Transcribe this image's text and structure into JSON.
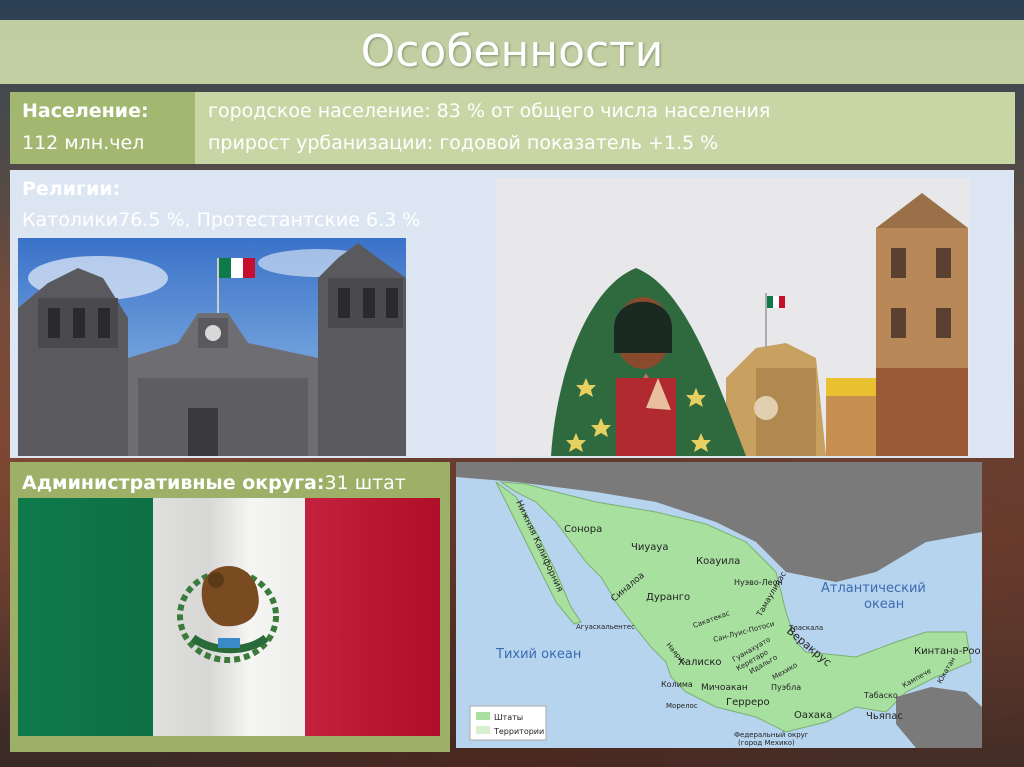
{
  "title": "Особенности",
  "population": {
    "label": "Население:",
    "value": "112 млн.чел",
    "urban_line1": "городское население: 83 % от общего числа населения",
    "urban_line2": "прирост урбанизации: годовой показатель +1.5 %"
  },
  "religion": {
    "label": "Религии:",
    "value": "Католики76.5 %, Протестантские 6.3 %"
  },
  "admin": {
    "label": "Административные округа:",
    "value": "31 штат"
  },
  "map": {
    "states": [
      "Сонора",
      "Чиуауа",
      "Коауила",
      "Дуранго",
      "Синалоа",
      "Нижняя Калифорния",
      "Нуэво-Леон",
      "Тамаулипас",
      "Сакатекас",
      "Сан-Луис-Потоси",
      "Агуаскальентес",
      "Наярит",
      "Халиско",
      "Гуанахуато",
      "Керетаро",
      "Идальго",
      "Мичоакан",
      "Колима",
      "Мехико",
      "Морелос",
      "Герреро",
      "Пуэбла",
      "Тласкала",
      "Веракрус",
      "Оахака",
      "Табаско",
      "Чьяпас",
      "Кампече",
      "Юкатан",
      "Кинтана-Роо"
    ],
    "ocean_atlantic": "Атлантический океан",
    "ocean_atlantic_1": "Атлантический",
    "ocean_atlantic_2": "океан",
    "ocean_pacific": "Тихий океан",
    "legend_states": "Штаты",
    "legend_territories": "Территории",
    "federal_district_1": "Федеральный округ",
    "federal_district_2": "(город Мехико)"
  },
  "colors": {
    "title_band": "#c8d6a6",
    "pop_left": "#a2b870",
    "religion_panel": "#dce6f2",
    "admin_panel": "#9cb068",
    "map_land": "#a8e0a0",
    "map_water": "#b6d4ee",
    "flag_green": "#0e7a4a",
    "flag_red": "#c4102e"
  }
}
